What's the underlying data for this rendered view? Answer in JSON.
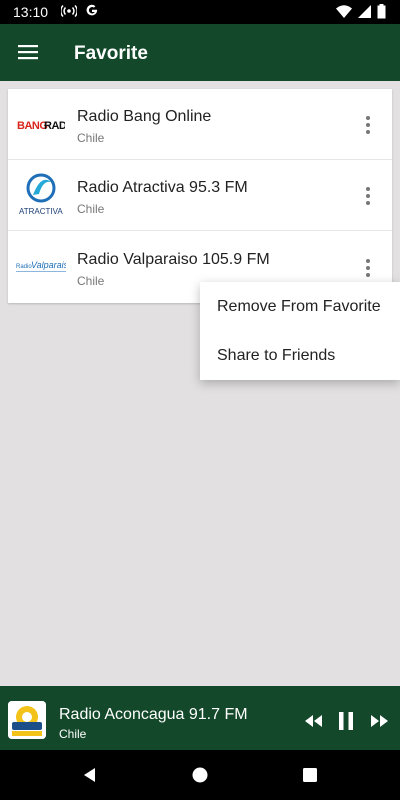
{
  "status_bar": {
    "time": "13:10",
    "left_icons": [
      "hotspot-icon",
      "google-g-icon"
    ],
    "right_icons": [
      "wifi-icon",
      "signal-icon",
      "battery-icon"
    ]
  },
  "app_bar": {
    "title": "Favorite",
    "menu_icon": "hamburger-menu-icon",
    "color": "#13492a"
  },
  "favorites": [
    {
      "logo_text": "BANGRADIO",
      "name": "Radio Bang Online",
      "country": "Chile"
    },
    {
      "logo_text": "ATRACTIVA",
      "name": "Radio Atractiva 95.3 FM",
      "country": "Chile"
    },
    {
      "logo_text": "RadioValparaiso",
      "name": "Radio Valparaiso 105.9 FM",
      "country": "Chile"
    }
  ],
  "context_menu": {
    "items": [
      "Remove From Favorite",
      "Share to Friends"
    ]
  },
  "player": {
    "title": "Radio Aconcagua 91.7 FM",
    "country": "Chile",
    "state": "playing",
    "controls": [
      "previous-icon",
      "pause-icon",
      "next-icon"
    ]
  },
  "nav_bar": {
    "buttons": [
      "back-icon",
      "home-icon",
      "recents-icon"
    ]
  }
}
